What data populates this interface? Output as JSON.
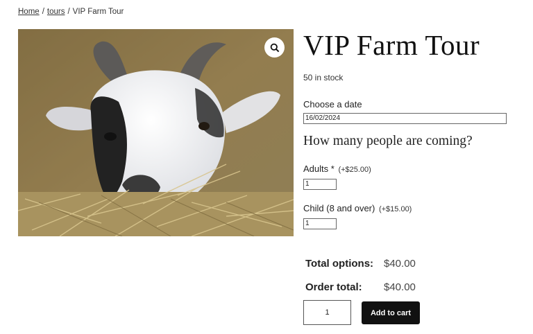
{
  "breadcrumb": {
    "home": "Home",
    "separator": "/",
    "tours": "tours",
    "current": "VIP Farm Tour"
  },
  "product": {
    "title": "VIP Farm Tour",
    "stock": "50 in stock",
    "image_alt": "goat-in-hay-photo"
  },
  "booking": {
    "date_label": "Choose a date",
    "date_value": "16/02/2024",
    "people_heading": "How many people are coming?",
    "options": [
      {
        "label": "Adults *",
        "price": "(+$25.00)",
        "qty": "1"
      },
      {
        "label": "Child (8 and over)",
        "price": "(+$15.00)",
        "qty": "1"
      }
    ]
  },
  "totals": {
    "options_label": "Total options:",
    "options_value": "$40.00",
    "order_label": "Order total:",
    "order_value": "$40.00"
  },
  "cart": {
    "quantity": "1",
    "button_label": "Add to cart"
  },
  "icons": {
    "zoom": "magnifier-icon"
  },
  "colors": {
    "button_bg": "#111111",
    "text": "#1e1e1e"
  }
}
